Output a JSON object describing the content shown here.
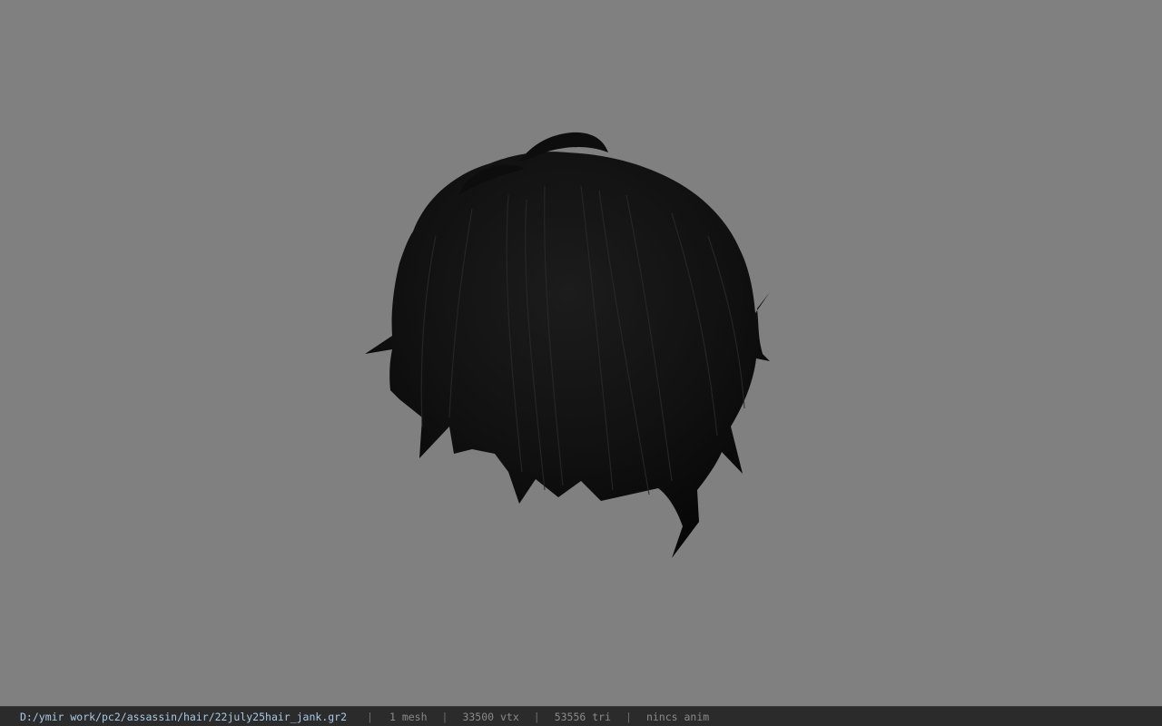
{
  "viewport": {
    "background": "#808080",
    "model_name": "hair-mesh",
    "model_color": "#0c0c0c"
  },
  "statusbar": {
    "file_path": "D:/ymir work/pc2/assassin/hair/22july25hair_jank.gr2",
    "separator": "|",
    "mesh_count": "1 mesh",
    "vertex_count": "33500 vtx",
    "triangle_count": "53556 tri",
    "anim_status": "nincs anim"
  }
}
